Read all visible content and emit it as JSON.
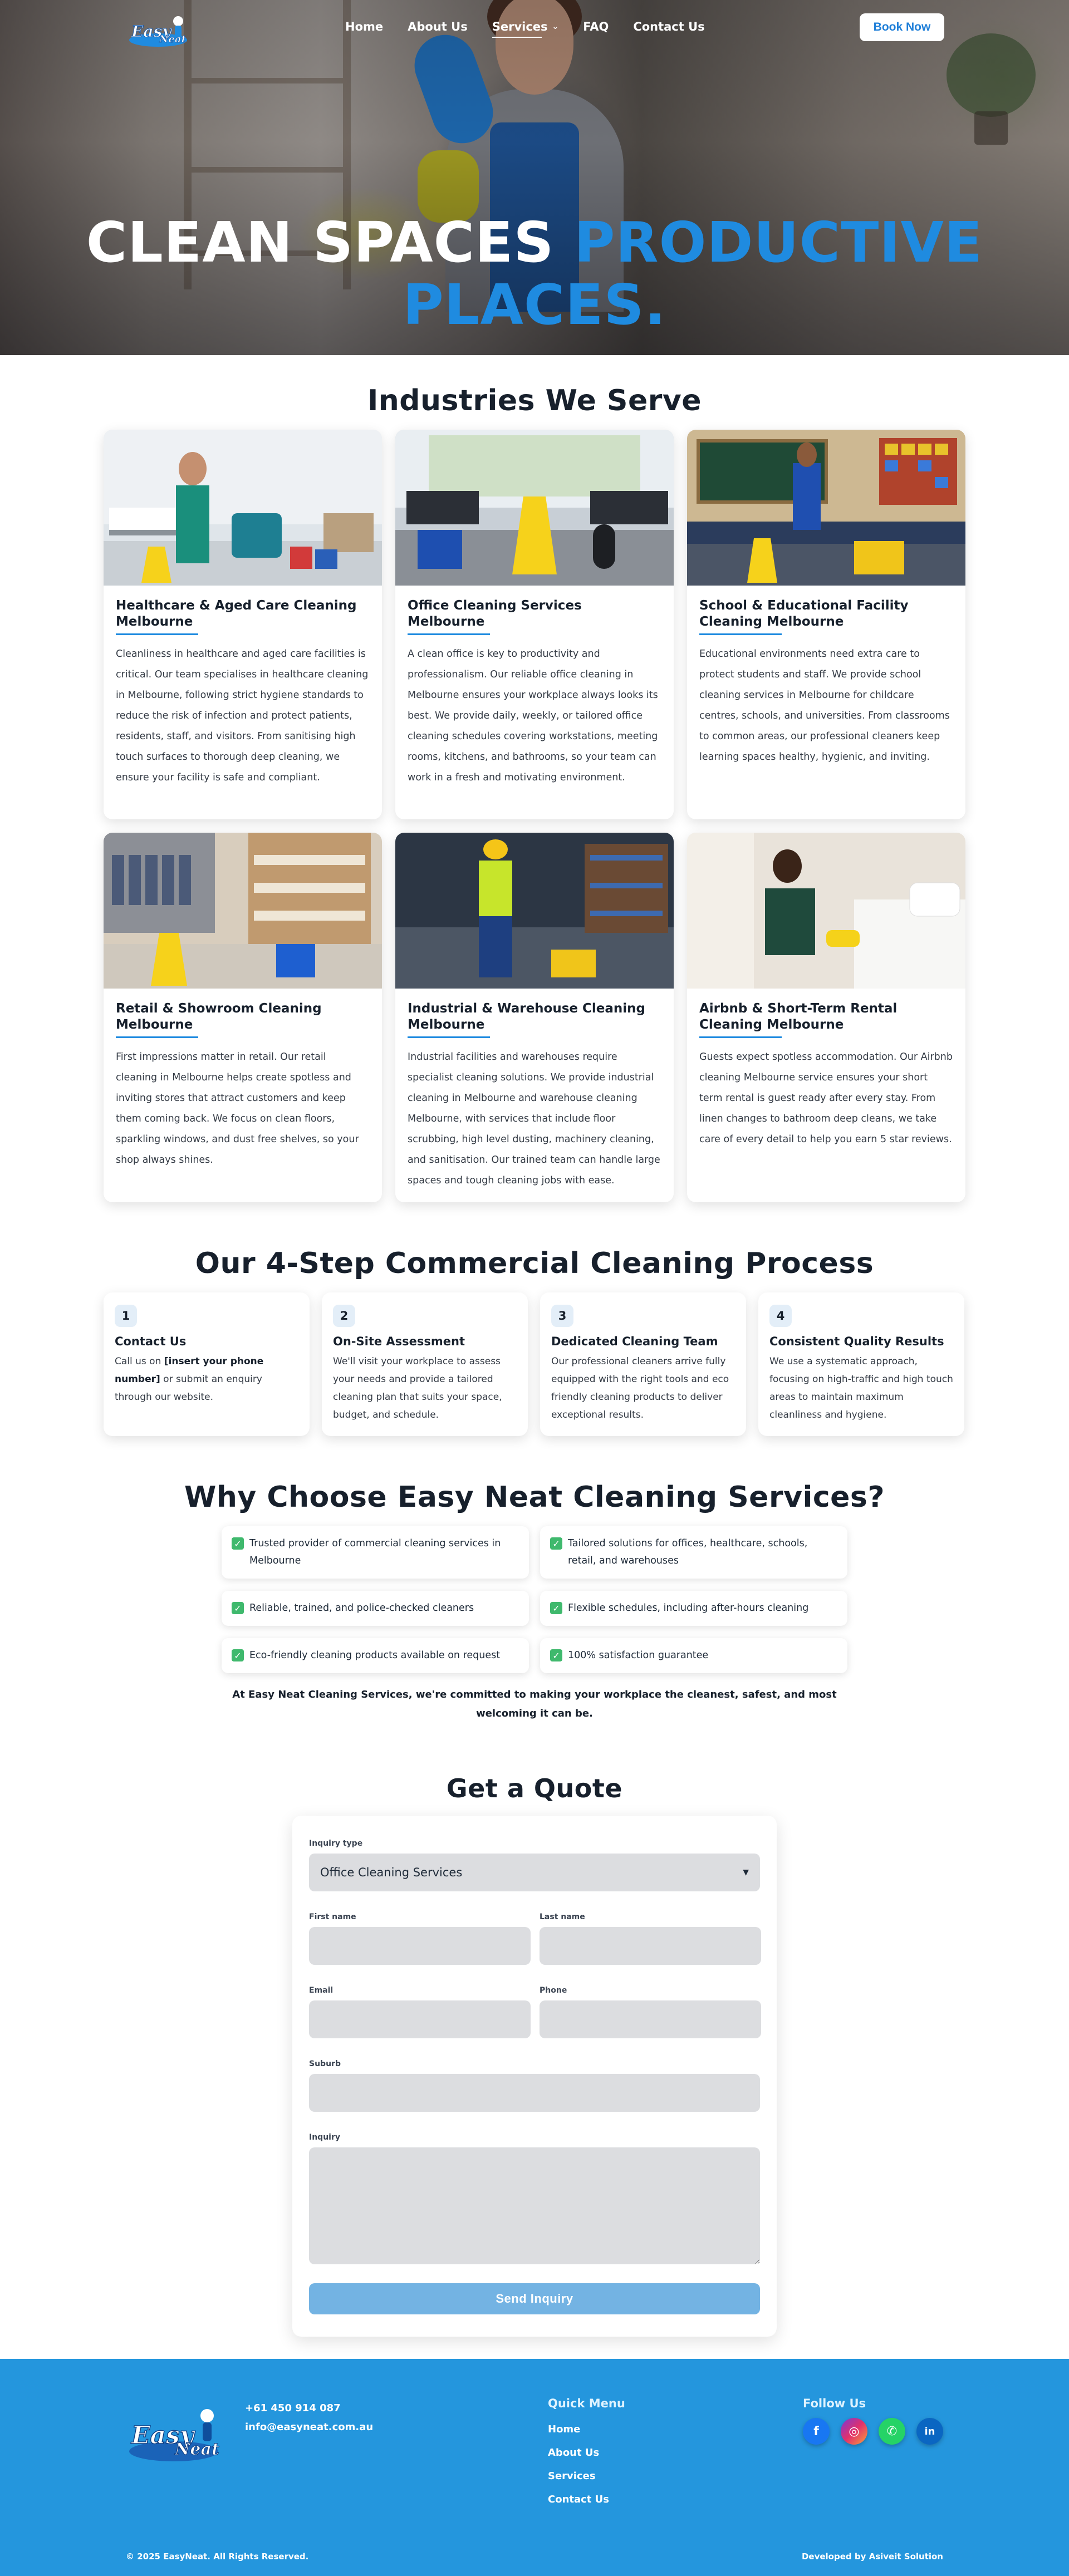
{
  "brand": {
    "name": "Easy Neat",
    "logo_text_1": "Easy",
    "logo_text_2": "Neat",
    "primary": "#1f8be0",
    "footer_bg": "#2496dd"
  },
  "nav": {
    "items": [
      {
        "label": "Home"
      },
      {
        "label": "About Us"
      },
      {
        "label": "Services",
        "dropdown": true,
        "active": true
      },
      {
        "label": "FAQ"
      },
      {
        "label": "Contact Us"
      }
    ],
    "cta": "Book Now"
  },
  "hero": {
    "title_white": "CLEAN SPACES ",
    "title_blue_1": "PRODUCTIVE",
    "title_blue_2": "PLACES."
  },
  "industries": {
    "heading": "Industries We Serve",
    "cards": [
      {
        "title": "Healthcare & Aged Care Cleaning Melbourne",
        "text": "Cleanliness in healthcare and aged care facilities is critical. Our team specialises in healthcare cleaning in Melbourne, following strict hygiene standards to reduce the risk of infection and protect patients, residents, staff, and visitors. From sanitising high touch surfaces to thorough deep cleaning, we ensure your facility is safe and compliant."
      },
      {
        "title": "Office Cleaning Services Melbourne",
        "text": "A clean office is key to productivity and professionalism. Our reliable office cleaning in Melbourne ensures your workplace always looks its best. We provide daily, weekly, or tailored office cleaning schedules covering workstations, meeting rooms, kitchens, and bathrooms, so your team can work in a fresh and motivating environment."
      },
      {
        "title": "School & Educational Facility Cleaning Melbourne",
        "text": "Educational environments need extra care to protect students and staff. We provide school cleaning services in Melbourne for childcare centres, schools, and universities. From classrooms to common areas, our professional cleaners keep learning spaces healthy, hygienic, and inviting."
      },
      {
        "title": "Retail & Showroom Cleaning Melbourne",
        "text": "First impressions matter in retail. Our retail cleaning in Melbourne helps create spotless and inviting stores that attract customers and keep them coming back. We focus on clean floors, sparkling windows, and dust free shelves, so your shop always shines."
      },
      {
        "title": "Industrial & Warehouse Cleaning Melbourne",
        "text": "Industrial facilities and warehouses require specialist cleaning solutions. We provide industrial cleaning in Melbourne and warehouse cleaning Melbourne, with services that include floor scrubbing, high level dusting, machinery cleaning, and sanitisation. Our trained team can handle large spaces and tough cleaning jobs with ease."
      },
      {
        "title": "Airbnb & Short-Term Rental Cleaning Melbourne",
        "text": "Guests expect spotless accommodation. Our Airbnb cleaning Melbourne service ensures your short term rental is guest ready after every stay. From linen changes to bathroom deep cleans, we take care of every detail to help you earn 5 star reviews."
      }
    ],
    "sign_text": "CAUTION WET FLOOR"
  },
  "process": {
    "heading": "Our 4-Step Commercial Cleaning Process",
    "steps": [
      {
        "num": "1",
        "title": "Contact Us",
        "pre": "Call us on ",
        "bold": "[insert your phone number]",
        "post": " or submit an enquiry through our website."
      },
      {
        "num": "2",
        "title": "On-Site Assessment",
        "text": "We'll visit your workplace to assess your needs and provide a tailored cleaning plan that suits your space, budget, and schedule."
      },
      {
        "num": "3",
        "title": "Dedicated Cleaning Team",
        "text": "Our professional cleaners arrive fully equipped with the right tools and eco friendly cleaning products to deliver exceptional results."
      },
      {
        "num": "4",
        "title": "Consistent Quality Results",
        "text": "We use a systematic approach, focusing on high-traffic and high touch areas to maintain maximum cleanliness and hygiene."
      }
    ]
  },
  "why": {
    "heading": "Why Choose Easy Neat Cleaning Services?",
    "items": [
      "Trusted provider of commercial cleaning services in Melbourne",
      "Tailored solutions for offices, healthcare, schools, retail, and warehouses",
      "Reliable, trained, and police-checked cleaners",
      "Flexible schedules, including after-hours cleaning",
      "Eco-friendly cleaning products available on request",
      "100% satisfaction guarantee"
    ],
    "note": "At Easy Neat Cleaning Services, we're committed to making your workplace the cleanest, safest, and most welcoming it can be."
  },
  "quote": {
    "heading": "Get a Quote",
    "inquiry_type_label": "Inquiry type",
    "inquiry_type_value": "Office Cleaning Services",
    "first_name": "First name",
    "last_name": "Last name",
    "email": "Email",
    "phone": "Phone",
    "suburb": "Suburb",
    "inquiry": "Inquiry",
    "submit": "Send Inquiry"
  },
  "footer": {
    "phone": "+61 450 914 087",
    "email": "info@easyneat.com.au",
    "menu_heading": "Quick Menu",
    "menu": [
      "Home",
      "About Us",
      "Services",
      "Contact Us"
    ],
    "follow_heading": "Follow Us",
    "socials": [
      {
        "name": "facebook",
        "glyph": "f",
        "color": "#1877f2"
      },
      {
        "name": "instagram",
        "glyph": "◎",
        "color": "#c13584"
      },
      {
        "name": "whatsapp",
        "glyph": "✆",
        "color": "#25d366"
      },
      {
        "name": "linkedin",
        "glyph": "in",
        "color": "#0a66c2"
      }
    ],
    "copyright": "© 2025 EasyNeat. All Rights Reserved.",
    "developer": "Developed by Asiveit Solution"
  }
}
